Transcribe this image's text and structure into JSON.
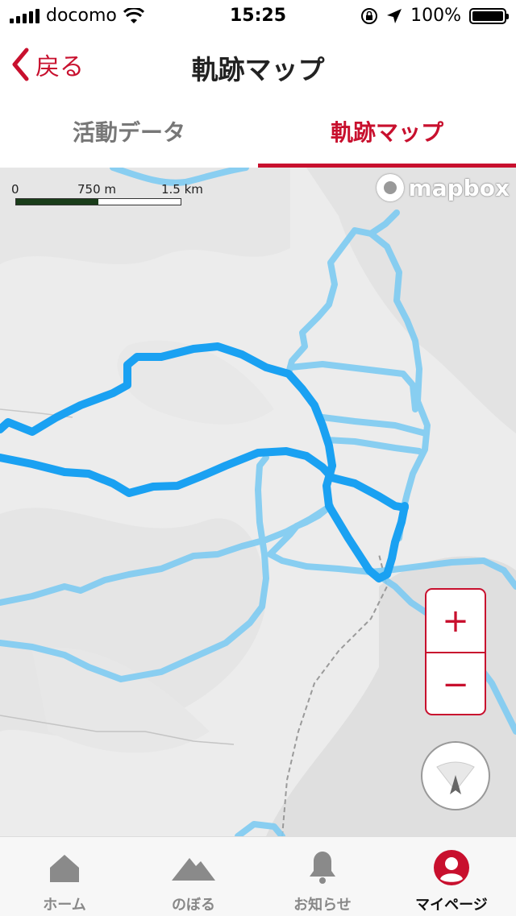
{
  "status_bar": {
    "carrier": "docomo",
    "time": "15:25",
    "battery": "100%"
  },
  "nav": {
    "back_label": "戻る",
    "title": "軌跡マップ"
  },
  "tabs": [
    {
      "label": "活動データ",
      "active": false
    },
    {
      "label": "軌跡マップ",
      "active": true
    }
  ],
  "map": {
    "scale_labels": [
      "0",
      "750 m",
      "1.5 km"
    ],
    "attribution": "mapbox",
    "zoom_in": "+",
    "zoom_out": "−"
  },
  "tab_bar": [
    {
      "label": "ホーム",
      "icon": "home-icon"
    },
    {
      "label": "のぼる",
      "icon": "mountain-icon"
    },
    {
      "label": "お知らせ",
      "icon": "bell-icon"
    },
    {
      "label": "マイページ",
      "icon": "user-icon",
      "active": true
    }
  ],
  "colors": {
    "accent": "#c8102e",
    "track": "#1da1f2",
    "track_light": "#7ecbf2"
  }
}
